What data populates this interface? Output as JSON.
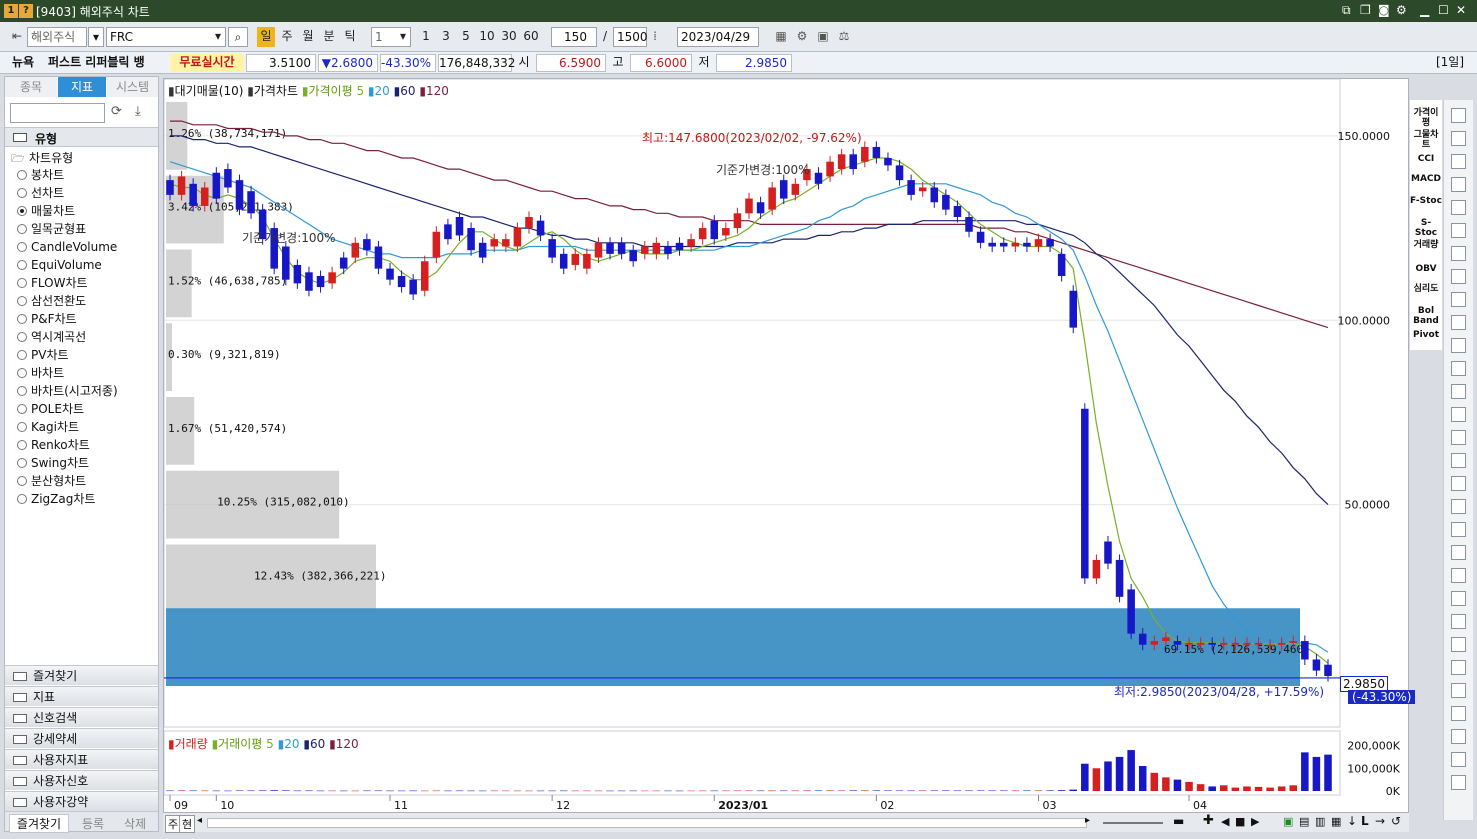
{
  "window": {
    "title": "[9403] 해외주식 차트",
    "badge1": "1",
    "badge2": "?"
  },
  "toolbar": {
    "market": "해외주식",
    "symbol": "FRC",
    "periods": [
      "일",
      "주",
      "월",
      "분",
      "틱"
    ],
    "interval_select": "1",
    "quick_intervals": [
      "1",
      "3",
      "5",
      "10",
      "30",
      "60"
    ],
    "count": "150",
    "total": "1500",
    "separator": "/",
    "date": "2023/04/29"
  },
  "quote": {
    "exchange": "뉴욕",
    "name": "퍼스트 리퍼블릭 뱅",
    "realtime": "무료실시간",
    "price": "3.5100",
    "change": "▼2.6800",
    "change_pct": "-43.30%",
    "volume": "176,848,332",
    "open_label": "시",
    "open": "6.5900",
    "high_label": "고",
    "high": "6.6000",
    "low_label": "저",
    "low": "2.9850",
    "period_badge": "[1일]"
  },
  "left": {
    "tabs": [
      "종목",
      "지표",
      "시스템"
    ],
    "group_title": "유형",
    "tree_root": "차트유형",
    "chart_types": [
      "봉차트",
      "선차트",
      "매물차트",
      "일목균형표",
      "CandleVolume",
      "EquiVolume",
      "FLOW차트",
      "삼선전환도",
      "P&F차트",
      "역시계곡선",
      "PV차트",
      "바차트",
      "바차트(시고저종)",
      "POLE차트",
      "Kagi차트",
      "Renko차트",
      "Swing차트",
      "분산형차트",
      "ZigZag차트"
    ],
    "selected_index": 2,
    "accordions": [
      "즐겨찾기",
      "지표",
      "신호검색",
      "강세약세",
      "사용자지표",
      "사용자신호",
      "사용자강약"
    ],
    "bottom_tabs": [
      "즐겨찾기",
      "등록",
      "삭제"
    ]
  },
  "price_panel": {
    "legend": {
      "vp": "대기매물(10)",
      "price": "가격차트",
      "ma_label": "가격이평",
      "ma": [
        "5",
        "20",
        "60",
        "120"
      ]
    },
    "colors": {
      "ma5": "#7ab026",
      "ma20": "#2f9ad6",
      "ma60": "#1b2270",
      "ma120": "#7a1f3e",
      "up": "#d62020",
      "down": "#1717c8",
      "vp_box": "#c8c8c8",
      "vp_highlight": "#3d8fc4"
    },
    "y_ticks": [
      "150.0000",
      "100.0000",
      "50.0000"
    ],
    "annotations": {
      "high": "최고:147.6800(2023/02/02, -97.62%)",
      "low": "최저:2.9850(2023/04/28, +17.59%)",
      "base1": "기준가변경:100%",
      "base2": "기준가변경:100%"
    },
    "current_price": "2.9850",
    "current_pct": "(-43.30%)",
    "volume_profile": [
      {
        "label": "1.26% (38,734,171)",
        "pct": 1.26
      },
      {
        "label": "3.42% (105,291,383)",
        "pct": 3.42
      },
      {
        "label": "1.52% (46,638,785)",
        "pct": 1.52
      },
      {
        "label": "0.30% (9,321,819)",
        "pct": 0.3
      },
      {
        "label": "1.67% (51,420,574)",
        "pct": 1.67
      },
      {
        "label": "10.25% (315,082,010)",
        "pct": 10.25
      },
      {
        "label": "12.43% (382,366,221)",
        "pct": 12.43
      },
      {
        "label": "69.15% (2,126,539,460)",
        "pct": 69.15
      }
    ]
  },
  "volume_panel": {
    "legend": {
      "vol": "거래량",
      "ma_label": "거래이평",
      "ma": [
        "5",
        "20",
        "60",
        "120"
      ]
    },
    "y_ticks": [
      "200,000K",
      "100,000K",
      "0K"
    ]
  },
  "x_axis": [
    "09",
    "10",
    "11",
    "12",
    "2023/01",
    "02",
    "03",
    "04"
  ],
  "bottom": {
    "left_label": "주",
    "left_label2": "현"
  },
  "right_tools": [
    "가격이평",
    "그물차트",
    "CCI",
    "MACD",
    "F-Stoc",
    "S-Stoc",
    "거래량",
    "OBV",
    "심리도",
    "Bol Band",
    "Pivot"
  ],
  "chart_data": {
    "type": "candlestick",
    "y_range": [
      0,
      160
    ],
    "candles": [
      [
        138,
        134
      ],
      [
        134,
        139
      ],
      [
        137,
        131
      ],
      [
        131,
        136
      ],
      [
        140,
        133
      ],
      [
        141,
        136
      ],
      [
        138,
        130
      ],
      [
        135,
        129
      ],
      [
        130,
        122
      ],
      [
        125,
        114
      ],
      [
        120,
        111
      ],
      [
        115,
        110
      ],
      [
        113,
        108
      ],
      [
        112,
        109
      ],
      [
        110,
        113
      ],
      [
        117,
        114
      ],
      [
        117,
        121
      ],
      [
        122,
        119
      ],
      [
        120,
        114
      ],
      [
        114,
        111
      ],
      [
        112,
        109
      ],
      [
        111,
        107
      ],
      [
        108,
        116
      ],
      [
        117,
        124
      ],
      [
        126,
        122
      ],
      [
        128,
        123
      ],
      [
        125,
        119
      ],
      [
        121,
        117
      ],
      [
        120,
        122
      ],
      [
        120,
        122
      ],
      [
        120,
        125
      ],
      [
        125,
        128
      ],
      [
        127,
        123
      ],
      [
        122,
        117
      ],
      [
        118,
        114
      ],
      [
        115,
        118
      ],
      [
        114,
        118
      ],
      [
        117,
        121
      ],
      [
        121,
        118
      ],
      [
        121,
        118
      ],
      [
        119,
        116
      ],
      [
        118,
        120
      ],
      [
        118,
        121
      ],
      [
        120,
        118
      ],
      [
        121,
        119
      ],
      [
        120,
        122
      ],
      [
        122,
        125
      ],
      [
        127,
        122
      ],
      [
        123,
        125
      ],
      [
        125,
        129
      ],
      [
        129,
        133
      ],
      [
        132,
        129
      ],
      [
        130,
        136
      ],
      [
        138,
        133
      ],
      [
        134,
        137
      ],
      [
        138,
        141
      ],
      [
        140,
        137
      ],
      [
        139,
        143
      ],
      [
        141,
        145
      ],
      [
        145,
        141
      ],
      [
        143,
        147
      ],
      [
        147,
        144
      ],
      [
        144,
        142
      ],
      [
        142,
        138
      ],
      [
        138,
        134
      ],
      [
        135,
        136
      ],
      [
        136,
        132
      ],
      [
        134,
        130
      ],
      [
        131,
        128
      ],
      [
        128,
        124
      ],
      [
        124,
        121
      ],
      [
        121,
        120
      ],
      [
        121,
        120
      ],
      [
        120,
        121
      ],
      [
        121,
        120
      ],
      [
        120,
        122
      ],
      [
        122,
        120
      ],
      [
        118,
        112
      ],
      [
        108,
        98
      ],
      [
        76,
        30
      ],
      [
        30,
        35
      ],
      [
        40,
        34
      ],
      [
        35,
        25
      ],
      [
        27,
        15
      ],
      [
        15,
        12
      ],
      [
        12,
        13
      ],
      [
        13,
        14
      ],
      [
        13,
        12
      ],
      [
        12,
        12.5
      ],
      [
        12,
        12.5
      ],
      [
        12.5,
        12
      ],
      [
        12,
        12.5
      ],
      [
        12,
        12.5
      ],
      [
        12,
        12.5
      ],
      [
        12,
        12.5
      ],
      [
        12,
        12
      ],
      [
        12,
        12.5
      ],
      [
        12.5,
        13
      ],
      [
        13,
        8
      ],
      [
        8,
        5
      ],
      [
        6.59,
        3.51
      ]
    ],
    "volume_k": [
      2000,
      2500,
      2000,
      1800,
      1600,
      1500,
      2200,
      2000,
      2400,
      3000,
      2500,
      1800,
      2000,
      1500,
      1600,
      1500,
      1400,
      1800,
      2000,
      1600,
      1500,
      1700,
      1500,
      1800,
      1600,
      1800,
      1600,
      1500,
      1700,
      1600,
      1500,
      1400,
      1500,
      1600,
      1700,
      1500,
      1600,
      1500,
      1400,
      1500,
      1600,
      1500,
      1600,
      1500,
      1400,
      1500,
      1600,
      1700,
      1800,
      1900,
      2000,
      1800,
      2100,
      1900,
      2000,
      2200,
      2100,
      2300,
      2200,
      2400,
      2500,
      2300,
      2200,
      2100,
      2000,
      2300,
      2100,
      2200,
      2000,
      2100,
      2200,
      2000,
      2100,
      2000,
      2200,
      2400,
      2500,
      3500,
      6000,
      120000,
      100000,
      130000,
      150000,
      180000,
      110000,
      80000,
      60000,
      50000,
      40000,
      30000,
      20000,
      25000,
      15000,
      20000,
      18000,
      15000,
      20000,
      25000,
      170000,
      150000,
      160000
    ],
    "ma5": [
      137,
      136,
      136,
      134,
      133,
      134,
      133,
      131,
      128,
      122,
      117,
      113,
      111,
      110,
      111,
      113,
      116,
      117,
      117,
      116,
      113,
      111,
      111,
      113,
      117,
      121,
      124,
      124,
      122,
      120,
      119,
      121,
      123,
      124,
      122,
      119,
      117,
      116,
      117,
      118,
      119,
      118,
      118,
      118,
      119,
      119,
      120,
      121,
      122,
      123,
      125,
      128,
      130,
      132,
      133,
      135,
      137,
      139,
      141,
      142,
      143,
      144,
      144,
      143,
      141,
      138,
      136,
      134,
      132,
      129,
      126,
      124,
      122,
      121,
      120,
      120,
      120,
      118,
      114,
      94,
      72,
      55,
      40,
      30,
      25,
      19,
      15,
      13,
      12.5,
      12.5,
      12.5,
      12.3,
      12.2,
      12.3,
      12.3,
      12.2,
      12.2,
      12.5,
      11.5,
      9.5,
      7
    ],
    "ma20": [
      143,
      142,
      141,
      140,
      139,
      138,
      137,
      136,
      134,
      132,
      130,
      128,
      126,
      124,
      122,
      121,
      120,
      119,
      118,
      118,
      117,
      117,
      117,
      117,
      118,
      118,
      118,
      119,
      119,
      119,
      119,
      120,
      120,
      120,
      120,
      120,
      119,
      119,
      119,
      119,
      119,
      119,
      119,
      119,
      119,
      119,
      119,
      119,
      120,
      120,
      120,
      121,
      122,
      123,
      124,
      125,
      127,
      128,
      130,
      131,
      133,
      134,
      135,
      136,
      137,
      137,
      137,
      137,
      136,
      135,
      134,
      132,
      131,
      129,
      128,
      126,
      124,
      122,
      119,
      112,
      104,
      97,
      89,
      81,
      73,
      65,
      57,
      49,
      42,
      35,
      28,
      23,
      19,
      16,
      14,
      13,
      13,
      12.5,
      12.5,
      12,
      10
    ],
    "ma60": [
      150,
      150,
      149,
      149,
      148,
      148,
      147,
      147,
      146,
      145,
      144,
      143,
      142,
      141,
      140,
      139,
      138,
      137,
      136,
      135,
      134,
      133,
      132,
      131,
      130,
      129,
      128,
      128,
      127,
      126,
      125,
      125,
      124,
      123,
      123,
      122,
      122,
      121,
      121,
      121,
      121,
      120,
      120,
      120,
      120,
      120,
      120,
      120,
      120,
      121,
      121,
      121,
      121,
      122,
      122,
      122,
      123,
      123,
      124,
      124,
      125,
      125,
      126,
      126,
      126,
      127,
      127,
      127,
      127,
      127,
      127,
      127,
      127,
      127,
      126,
      126,
      125,
      124,
      123,
      121,
      118,
      116,
      113,
      110,
      107,
      104,
      100,
      96,
      93,
      89,
      85,
      81,
      78,
      74,
      71,
      67,
      64,
      60,
      57,
      53,
      50
    ],
    "ma120": [
      154,
      154,
      153,
      153,
      153,
      152,
      152,
      152,
      151,
      151,
      150,
      150,
      149,
      149,
      148,
      148,
      147,
      146,
      146,
      145,
      144,
      144,
      143,
      142,
      141,
      141,
      140,
      139,
      138,
      138,
      137,
      136,
      135,
      135,
      134,
      133,
      133,
      132,
      131,
      131,
      130,
      130,
      129,
      129,
      128,
      128,
      128,
      127,
      127,
      127,
      127,
      126,
      126,
      126,
      126,
      126,
      126,
      126,
      126,
      126,
      126,
      126,
      126,
      126,
      126,
      126,
      126,
      126,
      126,
      126,
      125,
      125,
      125,
      124,
      124,
      123,
      122,
      121,
      120,
      119,
      118,
      117,
      116,
      115,
      114,
      113,
      112,
      111,
      110,
      109,
      108,
      107,
      106,
      105,
      104,
      103,
      102,
      101,
      100,
      99,
      98
    ]
  }
}
